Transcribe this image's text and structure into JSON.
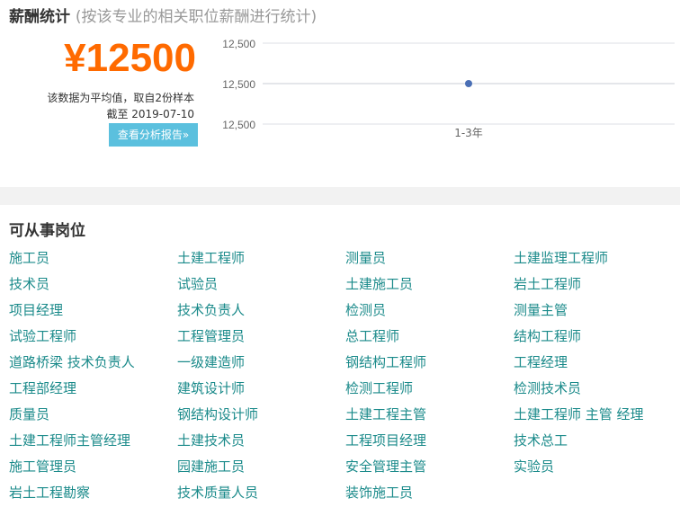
{
  "salary": {
    "title": "薪酬统计",
    "subtitle": "(按该专业的相关职位薪酬进行统计)",
    "amount": "¥12500",
    "note": "该数据为平均值，取自2份样本",
    "date": "截至 2019-07-10",
    "report_button": "查看分析报告»",
    "accent_color": "#ff6a00",
    "button_color": "#5bc0de"
  },
  "chart_data": {
    "type": "line",
    "categories": [
      "1-3年"
    ],
    "series": [
      {
        "values": [
          12500
        ]
      }
    ],
    "y_ticks": [
      "12,500",
      "12,500",
      "12,500"
    ],
    "xlabel": "",
    "ylabel": "",
    "grid": true,
    "point_color": "#4a6fb5"
  },
  "jobs": {
    "title": "可从事岗位",
    "link_color": "#1a8a8a",
    "items": [
      "施工员",
      "土建工程师",
      "测量员",
      "土建监理工程师",
      "技术员",
      "试验员",
      "土建施工员",
      "岩土工程师",
      "项目经理",
      "技术负责人",
      "检测员",
      "测量主管",
      "试验工程师",
      "工程管理员",
      "总工程师",
      "结构工程师",
      "道路桥梁 技术负责人",
      "一级建造师",
      "钢结构工程师",
      "工程经理",
      "工程部经理",
      "建筑设计师",
      "检测工程师",
      "检测技术员",
      "质量员",
      "钢结构设计师",
      "土建工程主管",
      "土建工程师 主管 经理",
      "土建工程师主管经理",
      "土建技术员",
      "工程项目经理",
      "技术总工",
      "施工管理员",
      "园建施工员",
      "安全管理主管",
      "实验员",
      "岩土工程勘察",
      "技术质量人员",
      "装饰施工员"
    ]
  }
}
